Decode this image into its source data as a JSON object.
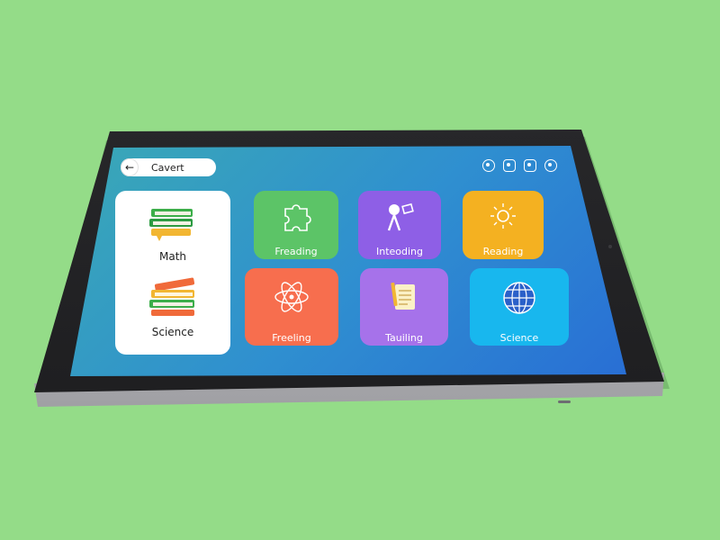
{
  "topbar": {
    "back_icon": "arrow-left-icon",
    "title": "Cavert",
    "icons": [
      "search-icon",
      "image-icon",
      "camera-icon",
      "settings-icon"
    ]
  },
  "subjects": [
    {
      "label": "Math",
      "icon": "books-icon"
    },
    {
      "label": "Science",
      "icon": "books-icon"
    }
  ],
  "tiles": [
    {
      "label": "Freading",
      "icon": "puzzle-icon",
      "color": "#5cc467"
    },
    {
      "label": "Inteoding",
      "icon": "lab-icon",
      "color": "#8e5fe6"
    },
    {
      "label": "Reading",
      "icon": "sun-icon",
      "color": "#f4b121"
    },
    {
      "label": "Freeling",
      "icon": "atom-icon",
      "color": "#f76e4e"
    },
    {
      "label": "Tauiling",
      "icon": "notebook-icon",
      "color": "#a672ea"
    },
    {
      "label": "Science",
      "icon": "globe-icon",
      "color": "#18b7ee"
    }
  ]
}
